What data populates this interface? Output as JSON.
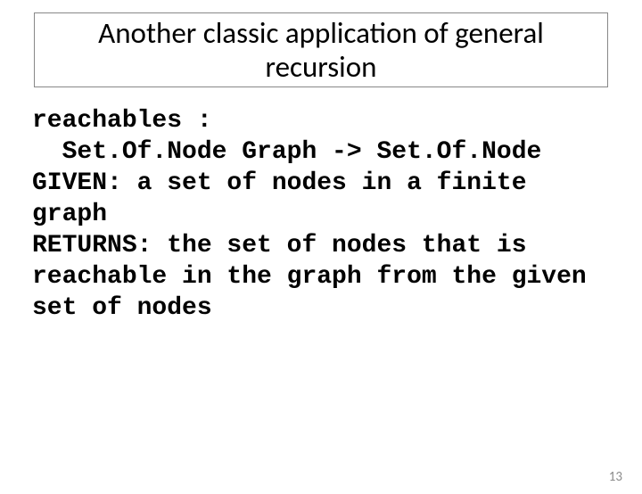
{
  "slide": {
    "title": "Another classic application of general recursion",
    "code": "reachables :\n  Set.Of.Node Graph -> Set.Of.Node\nGIVEN: a set of nodes in a finite graph\nRETURNS: the set of nodes that is reachable in the graph from the given set of nodes",
    "pageNumber": "13"
  }
}
